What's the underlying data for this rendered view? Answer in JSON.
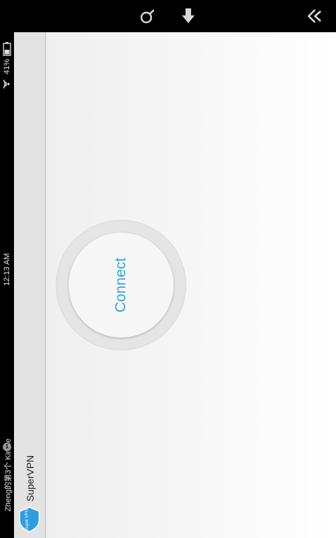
{
  "status_bar": {
    "device_name": "Zheng的第3个 Kindle",
    "notification_count": "1",
    "time": "12:13 AM",
    "battery": "41%",
    "icons": [
      "wifi-icon",
      "battery-icon"
    ]
  },
  "nav_bar": {
    "icons": [
      "search-icon",
      "download-icon",
      "back-icon"
    ]
  },
  "app_bar": {
    "title": "SuperVPN",
    "logo_text": "Super VPN"
  },
  "main": {
    "connect_label": "Connect",
    "accent_color": "#2ea7e0"
  }
}
